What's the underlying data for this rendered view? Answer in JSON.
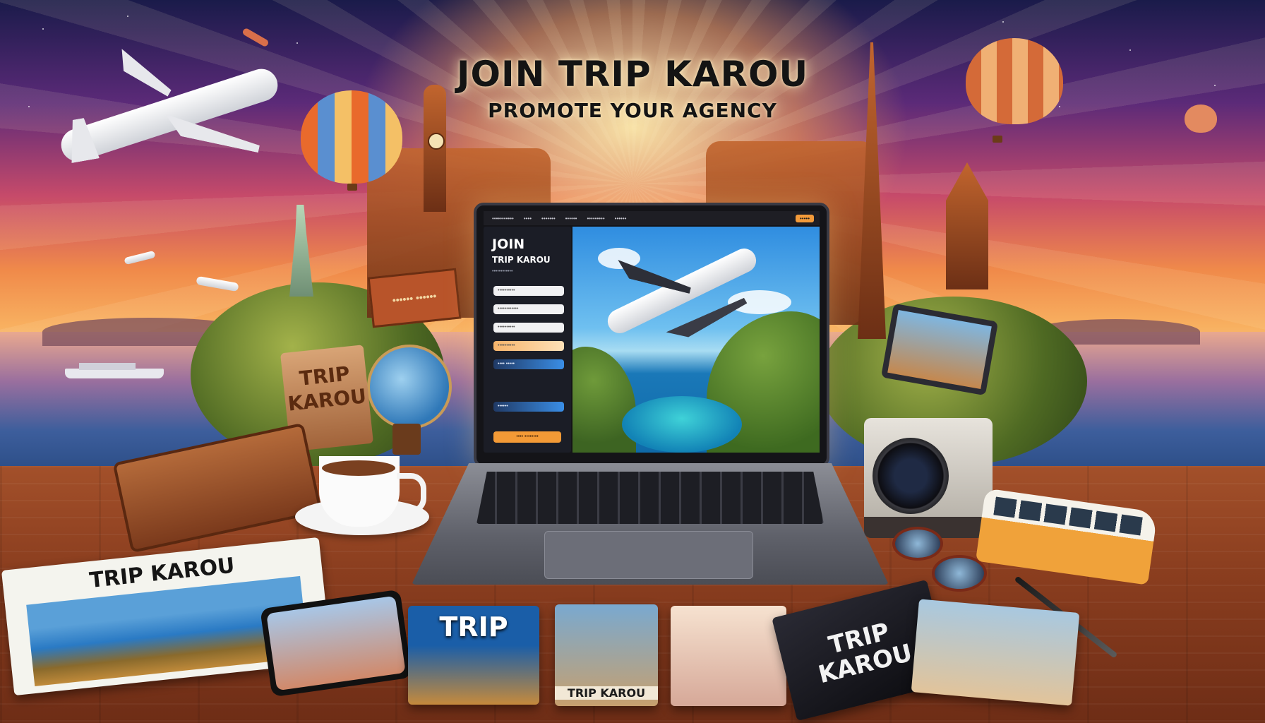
{
  "headline": {
    "title": "JOIN TRIP KAROU",
    "subtitle": "PROMOTE YOUR AGENCY"
  },
  "laptop": {
    "nav": [
      "•••••••••••",
      "••••",
      "•••••••",
      "••••••",
      "•••••••••",
      "••••••",
      "••••"
    ],
    "nav_cta": "•••••",
    "form": {
      "title": "JOIN",
      "subtitle": "TRIP KAROU",
      "caption": "••••••••••••",
      "fields": [
        "••••••••••",
        "••••••••••••",
        "••••••••••",
        "••••••••••",
        "•••• •••••",
        "••••••"
      ],
      "submit": "•••• ••••••••"
    }
  },
  "props": {
    "magazine_left": "TRIP KAROU",
    "box_label": "TRIP KAROU",
    "brochure_1": "TRIP",
    "brochure_2": "TRIP KAROU",
    "booklet": "TRIP KAROU",
    "sign": "•••••• ••••••"
  },
  "colors": {
    "accent_orange": "#f39a36",
    "field_blue": "#3a8ee6",
    "desk": "#8b3e1f"
  }
}
